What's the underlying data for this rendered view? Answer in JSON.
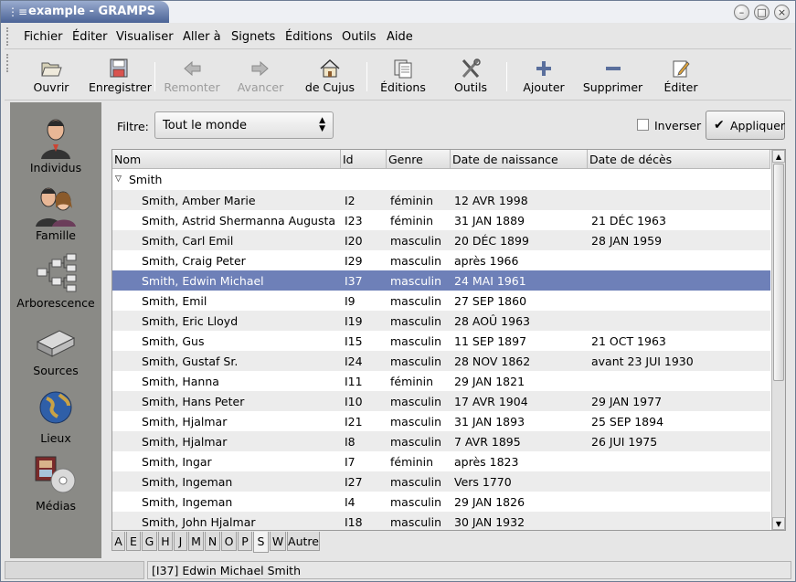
{
  "window": {
    "title": "example - GRAMPS",
    "buttons": [
      "minimize",
      "maximize",
      "close"
    ]
  },
  "menu": {
    "items": [
      "Fichier",
      "Éditer",
      "Visualiser",
      "Aller à",
      "Signets",
      "Éditions",
      "Outils",
      "Aide"
    ]
  },
  "toolbar": {
    "buttons": [
      {
        "label": "Ouvrir",
        "icon": "folder-open-icon",
        "enabled": true
      },
      {
        "label": "Enregistrer",
        "icon": "save-icon",
        "enabled": true
      },
      {
        "label": "Remonter",
        "icon": "arrow-left-icon",
        "enabled": false
      },
      {
        "label": "Avancer",
        "icon": "arrow-right-icon",
        "enabled": false
      },
      {
        "label": "de Cujus",
        "icon": "home-icon",
        "enabled": true
      },
      {
        "label": "Éditions",
        "icon": "documents-icon",
        "enabled": true
      },
      {
        "label": "Outils",
        "icon": "tools-icon",
        "enabled": true
      },
      {
        "label": "Ajouter",
        "icon": "plus-icon",
        "enabled": true
      },
      {
        "label": "Supprimer",
        "icon": "minus-icon",
        "enabled": true
      },
      {
        "label": "Éditer",
        "icon": "edit-icon",
        "enabled": true
      }
    ]
  },
  "sidebar": {
    "items": [
      {
        "label": "Individus",
        "icon": "person-icon"
      },
      {
        "label": "Famille",
        "icon": "family-icon"
      },
      {
        "label": "Arborescence",
        "icon": "tree-icon"
      },
      {
        "label": "Sources",
        "icon": "book-icon"
      },
      {
        "label": "Lieux",
        "icon": "globe-icon"
      },
      {
        "label": "Médias",
        "icon": "media-icon"
      }
    ]
  },
  "filter": {
    "label": "Filtre:",
    "selected": "Tout le monde",
    "invert_label": "Inverser",
    "invert_checked": false,
    "apply_label": "Appliquer"
  },
  "table": {
    "columns": [
      "Nom",
      "Id",
      "Genre",
      "Date de naissance",
      "Date de décès"
    ],
    "group": "Smith",
    "selected_index": 4,
    "rows": [
      {
        "name": "Smith, Amber Marie",
        "id": "I2",
        "gender": "féminin",
        "birth": "12 AVR 1998",
        "death": ""
      },
      {
        "name": "Smith, Astrid Shermanna Augusta",
        "id": "I23",
        "gender": "féminin",
        "birth": "31 JAN 1889",
        "death": "21 DÉC 1963"
      },
      {
        "name": "Smith, Carl Emil",
        "id": "I20",
        "gender": "masculin",
        "birth": "20 DÉC 1899",
        "death": "28 JAN 1959"
      },
      {
        "name": "Smith, Craig Peter",
        "id": "I29",
        "gender": "masculin",
        "birth": "après 1966",
        "death": ""
      },
      {
        "name": "Smith, Edwin Michael",
        "id": "I37",
        "gender": "masculin",
        "birth": "24 MAI 1961",
        "death": ""
      },
      {
        "name": "Smith, Emil",
        "id": "I9",
        "gender": "masculin",
        "birth": "27 SEP 1860",
        "death": ""
      },
      {
        "name": "Smith, Eric Lloyd",
        "id": "I19",
        "gender": "masculin",
        "birth": "28 AOÛ 1963",
        "death": ""
      },
      {
        "name": "Smith, Gus",
        "id": "I15",
        "gender": "masculin",
        "birth": "11 SEP 1897",
        "death": "21 OCT 1963"
      },
      {
        "name": "Smith, Gustaf Sr.",
        "id": "I24",
        "gender": "masculin",
        "birth": "28 NOV 1862",
        "death": "avant 23 JUI 1930"
      },
      {
        "name": "Smith, Hanna",
        "id": "I11",
        "gender": "féminin",
        "birth": "29 JAN 1821",
        "death": ""
      },
      {
        "name": "Smith, Hans Peter",
        "id": "I10",
        "gender": "masculin",
        "birth": "17 AVR 1904",
        "death": "29 JAN 1977"
      },
      {
        "name": "Smith, Hjalmar",
        "id": "I21",
        "gender": "masculin",
        "birth": "31 JAN 1893",
        "death": "25 SEP 1894"
      },
      {
        "name": "Smith, Hjalmar",
        "id": "I8",
        "gender": "masculin",
        "birth": "7 AVR 1895",
        "death": "26 JUI 1975"
      },
      {
        "name": "Smith, Ingar",
        "id": "I7",
        "gender": "féminin",
        "birth": "après 1823",
        "death": ""
      },
      {
        "name": "Smith, Ingeman",
        "id": "I27",
        "gender": "masculin",
        "birth": "Vers 1770",
        "death": ""
      },
      {
        "name": "Smith, Ingeman",
        "id": "I4",
        "gender": "masculin",
        "birth": "29 JAN 1826",
        "death": ""
      },
      {
        "name": "Smith, John Hjalmar",
        "id": "I18",
        "gender": "masculin",
        "birth": "30 JAN 1932",
        "death": ""
      }
    ]
  },
  "letter_tabs": {
    "items": [
      "A",
      "E",
      "G",
      "H",
      "J",
      "M",
      "N",
      "O",
      "P",
      "S",
      "W",
      "Autre"
    ],
    "active": "S"
  },
  "status": {
    "text": "[I37] Edwin Michael Smith"
  },
  "colors": {
    "selection": "#6e80b8",
    "sidebar": "#8a8a86",
    "title_gradient_dark": "#4b6396"
  }
}
